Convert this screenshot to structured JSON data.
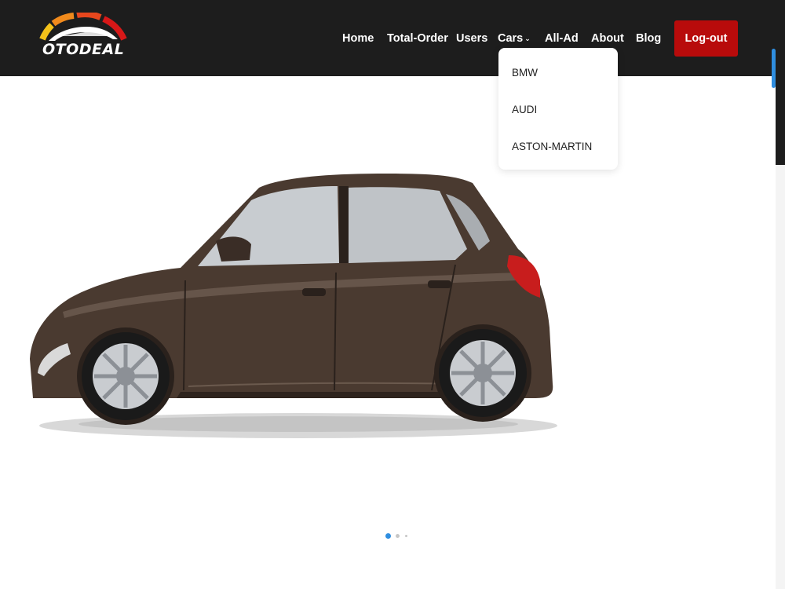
{
  "brand": {
    "name": "OTODEAL"
  },
  "nav": {
    "items": [
      {
        "label": "Home"
      },
      {
        "label": "Total-Order"
      },
      {
        "label": "Users"
      },
      {
        "label": "Cars"
      },
      {
        "label": "All-Ad"
      },
      {
        "label": "About"
      },
      {
        "label": "Blog"
      }
    ],
    "logout_label": "Log-out"
  },
  "cars_dropdown": {
    "items": [
      {
        "label": "BMW"
      },
      {
        "label": "AUDI"
      },
      {
        "label": "ASTON-MARTIN"
      }
    ]
  },
  "hero": {
    "image": "brown-hatchback-car",
    "slides": 3,
    "active_slide": 1
  },
  "colors": {
    "header_bg": "#1d1d1d",
    "logout_bg": "#b80b0b",
    "accent_blue": "#2f8ee0",
    "car_body": "#4a3a30"
  }
}
